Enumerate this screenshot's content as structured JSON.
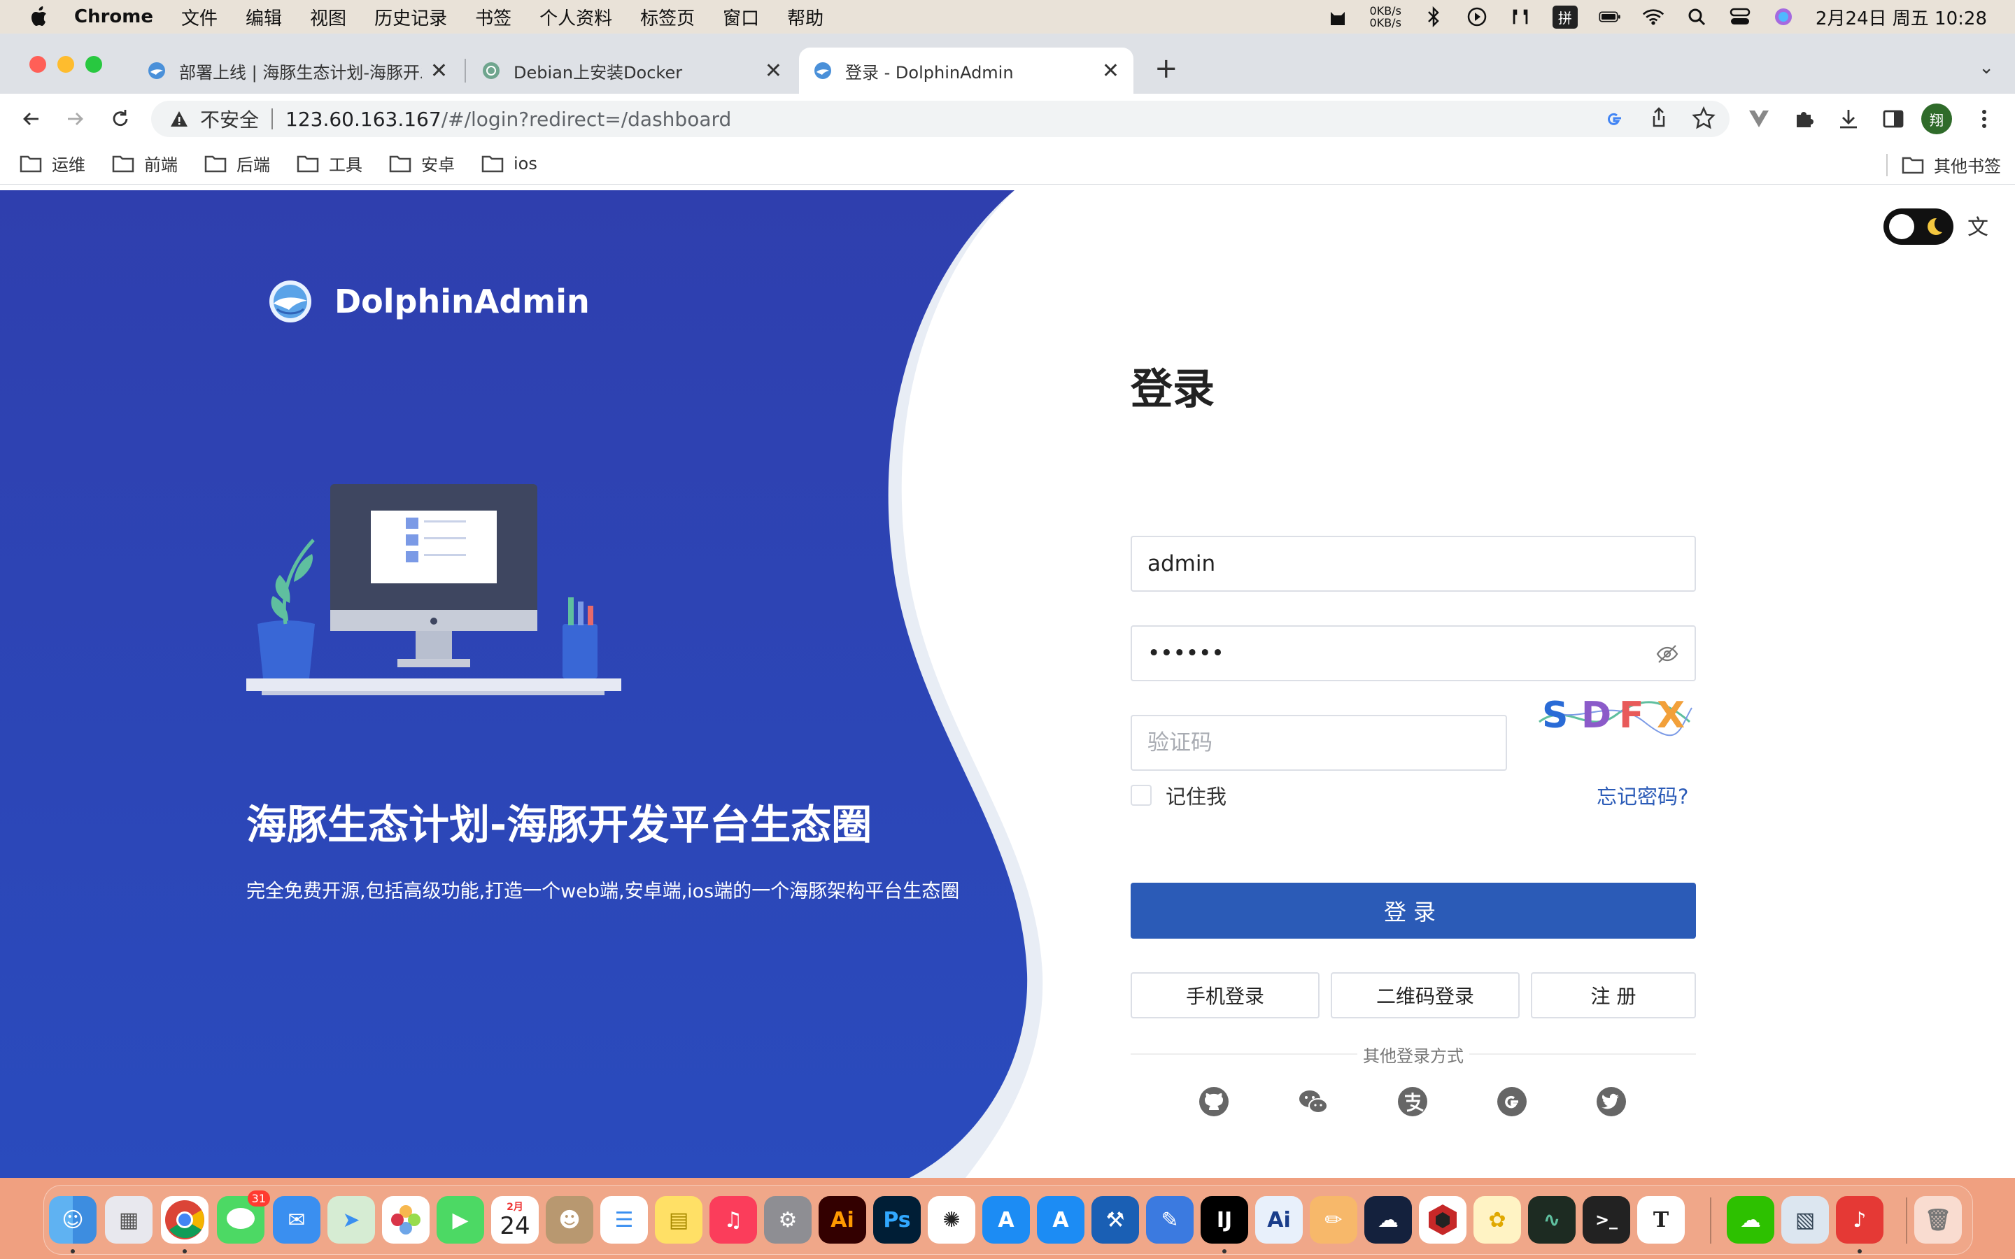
{
  "menubar": {
    "app_name": "Chrome",
    "items": [
      "文件",
      "编辑",
      "视图",
      "历史记录",
      "书签",
      "个人资料",
      "标签页",
      "窗口",
      "帮助"
    ],
    "net_up": "0KB/s",
    "net_down": "0KB/s",
    "ime": "拼",
    "datetime": "2月24日 周五  10:28"
  },
  "tabs": [
    {
      "title": "部署上线 | 海豚生态计划-海豚开发平台",
      "active": false
    },
    {
      "title": "Debian上安装Docker",
      "active": false
    },
    {
      "title": "登录 - DolphinAdmin",
      "active": true
    }
  ],
  "address_bar": {
    "security_label": "不安全",
    "host": "123.60.163.167",
    "path": "/#/login?redirect=/dashboard"
  },
  "profile_initial": "翔",
  "bookmarks": [
    "运维",
    "前端",
    "后端",
    "工具",
    "安卓",
    "ios"
  ],
  "other_bookmarks": "其他书签",
  "hero": {
    "brand": "DolphinAdmin",
    "title": "海豚生态计划-海豚开发平台生态圈",
    "subtitle": "完全免费开源,包括高级功能,打造一个web端,安卓端,ios端的一个海豚架构平台生态圈"
  },
  "login": {
    "title": "登录",
    "username_value": "admin",
    "password_value": "••••••",
    "captcha_placeholder": "验证码",
    "captcha_chars": [
      "S",
      "D",
      "F",
      "X"
    ],
    "remember_label": "记住我",
    "forgot_label": "忘记密码?",
    "submit_label": "登录",
    "alt_buttons": [
      "手机登录",
      "二维码登录",
      "注 册"
    ],
    "other_methods_label": "其他登录方式",
    "social_icons": [
      "github-icon",
      "wechat-icon",
      "alipay-icon",
      "google-icon",
      "twitter-icon"
    ]
  },
  "dock": {
    "messages_badge": "31",
    "calendar_month": "2月",
    "calendar_day": "24"
  },
  "colors": {
    "hero_blue": "#2b45b8",
    "primary": "#2b5bb7",
    "link": "#2b5bb7"
  }
}
